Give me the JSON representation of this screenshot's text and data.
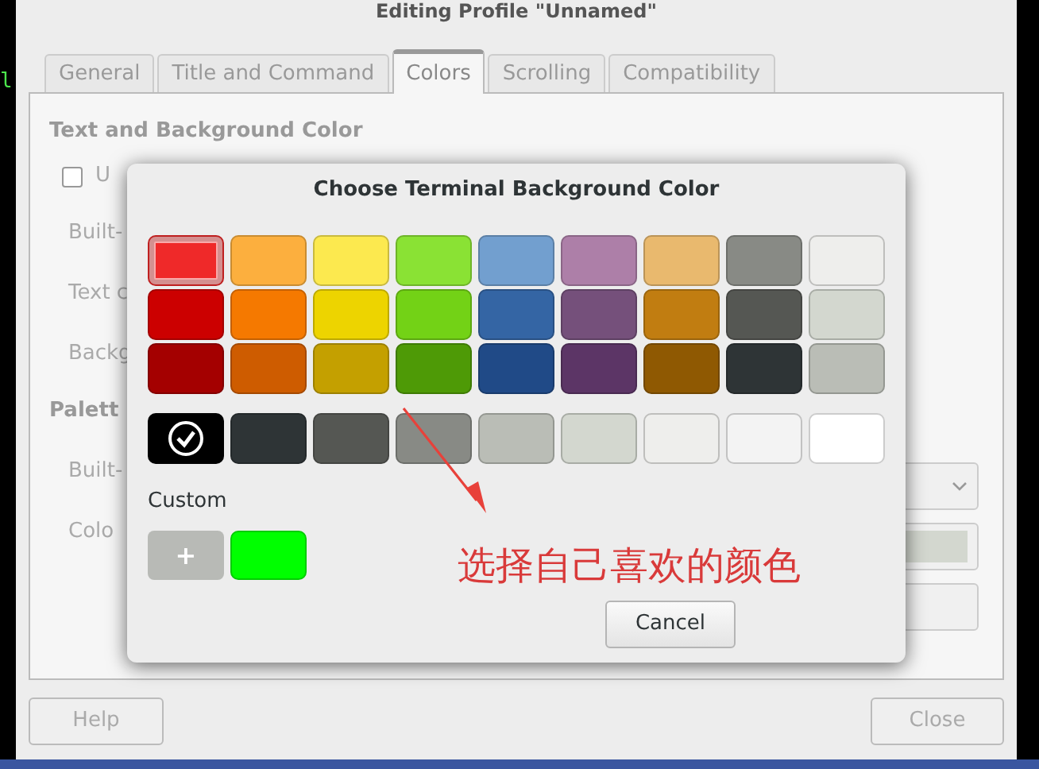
{
  "window": {
    "title": "Editing Profile \"Unnamed\""
  },
  "terminal": {
    "text": "l"
  },
  "tabs": [
    {
      "label": "General",
      "selected": false
    },
    {
      "label": "Title and Command",
      "selected": false
    },
    {
      "label": "Colors",
      "selected": true
    },
    {
      "label": "Scrolling",
      "selected": false
    },
    {
      "label": "Compatibility",
      "selected": false
    }
  ],
  "text_section": {
    "heading": "Text and Background Color",
    "checkbox": {
      "label": "U",
      "checked": false
    },
    "labels": [
      "Built-",
      "Text c",
      "Backg"
    ]
  },
  "palette_section": {
    "heading": "Palett",
    "labels": [
      "Built-",
      "Colo"
    ]
  },
  "buttons": {
    "help": "Help",
    "close": "Close"
  },
  "dialog": {
    "title": "Choose Terminal Background Color",
    "palette": [
      {
        "color": "#ef2929",
        "selected": false,
        "focused": true
      },
      {
        "color": "#fcaf3e",
        "selected": false,
        "focused": false
      },
      {
        "color": "#fce94f",
        "selected": false,
        "focused": false
      },
      {
        "color": "#8ae234",
        "selected": false,
        "focused": false
      },
      {
        "color": "#729fcf",
        "selected": false,
        "focused": false
      },
      {
        "color": "#ad7fa8",
        "selected": false,
        "focused": false
      },
      {
        "color": "#e9b96e",
        "selected": false,
        "focused": false
      },
      {
        "color": "#888a85",
        "selected": false,
        "focused": false
      },
      {
        "color": "#eeeeec",
        "selected": false,
        "focused": false
      },
      {
        "color": "#cc0000",
        "selected": false,
        "focused": false
      },
      {
        "color": "#f57900",
        "selected": false,
        "focused": false
      },
      {
        "color": "#edd400",
        "selected": false,
        "focused": false
      },
      {
        "color": "#73d216",
        "selected": false,
        "focused": false
      },
      {
        "color": "#3465a4",
        "selected": false,
        "focused": false
      },
      {
        "color": "#75507b",
        "selected": false,
        "focused": false
      },
      {
        "color": "#c17d11",
        "selected": false,
        "focused": false
      },
      {
        "color": "#555753",
        "selected": false,
        "focused": false
      },
      {
        "color": "#d3d7cf",
        "selected": false,
        "focused": false
      },
      {
        "color": "#a40000",
        "selected": false,
        "focused": false
      },
      {
        "color": "#ce5c00",
        "selected": false,
        "focused": false
      },
      {
        "color": "#c4a000",
        "selected": false,
        "focused": false
      },
      {
        "color": "#4e9a06",
        "selected": false,
        "focused": false
      },
      {
        "color": "#204a87",
        "selected": false,
        "focused": false
      },
      {
        "color": "#5c3566",
        "selected": false,
        "focused": false
      },
      {
        "color": "#8f5902",
        "selected": false,
        "focused": false
      },
      {
        "color": "#2e3436",
        "selected": false,
        "focused": false
      },
      {
        "color": "#babdb6",
        "selected": false,
        "focused": false
      }
    ],
    "grays": [
      {
        "color": "#000000",
        "selected": true
      },
      {
        "color": "#2e3436",
        "selected": false
      },
      {
        "color": "#555753",
        "selected": false
      },
      {
        "color": "#888a85",
        "selected": false
      },
      {
        "color": "#babdb6",
        "selected": false
      },
      {
        "color": "#d3d7cf",
        "selected": false
      },
      {
        "color": "#eeeeec",
        "selected": false
      },
      {
        "color": "#f3f3f3",
        "selected": false
      },
      {
        "color": "#ffffff",
        "selected": false
      }
    ],
    "custom_label": "Custom",
    "add_button": "+",
    "custom_colors": [
      {
        "color": "#00ff00",
        "selected": false
      }
    ],
    "cancel": "Cancel"
  },
  "annotation": {
    "text": "选择自己喜欢的颜色"
  }
}
